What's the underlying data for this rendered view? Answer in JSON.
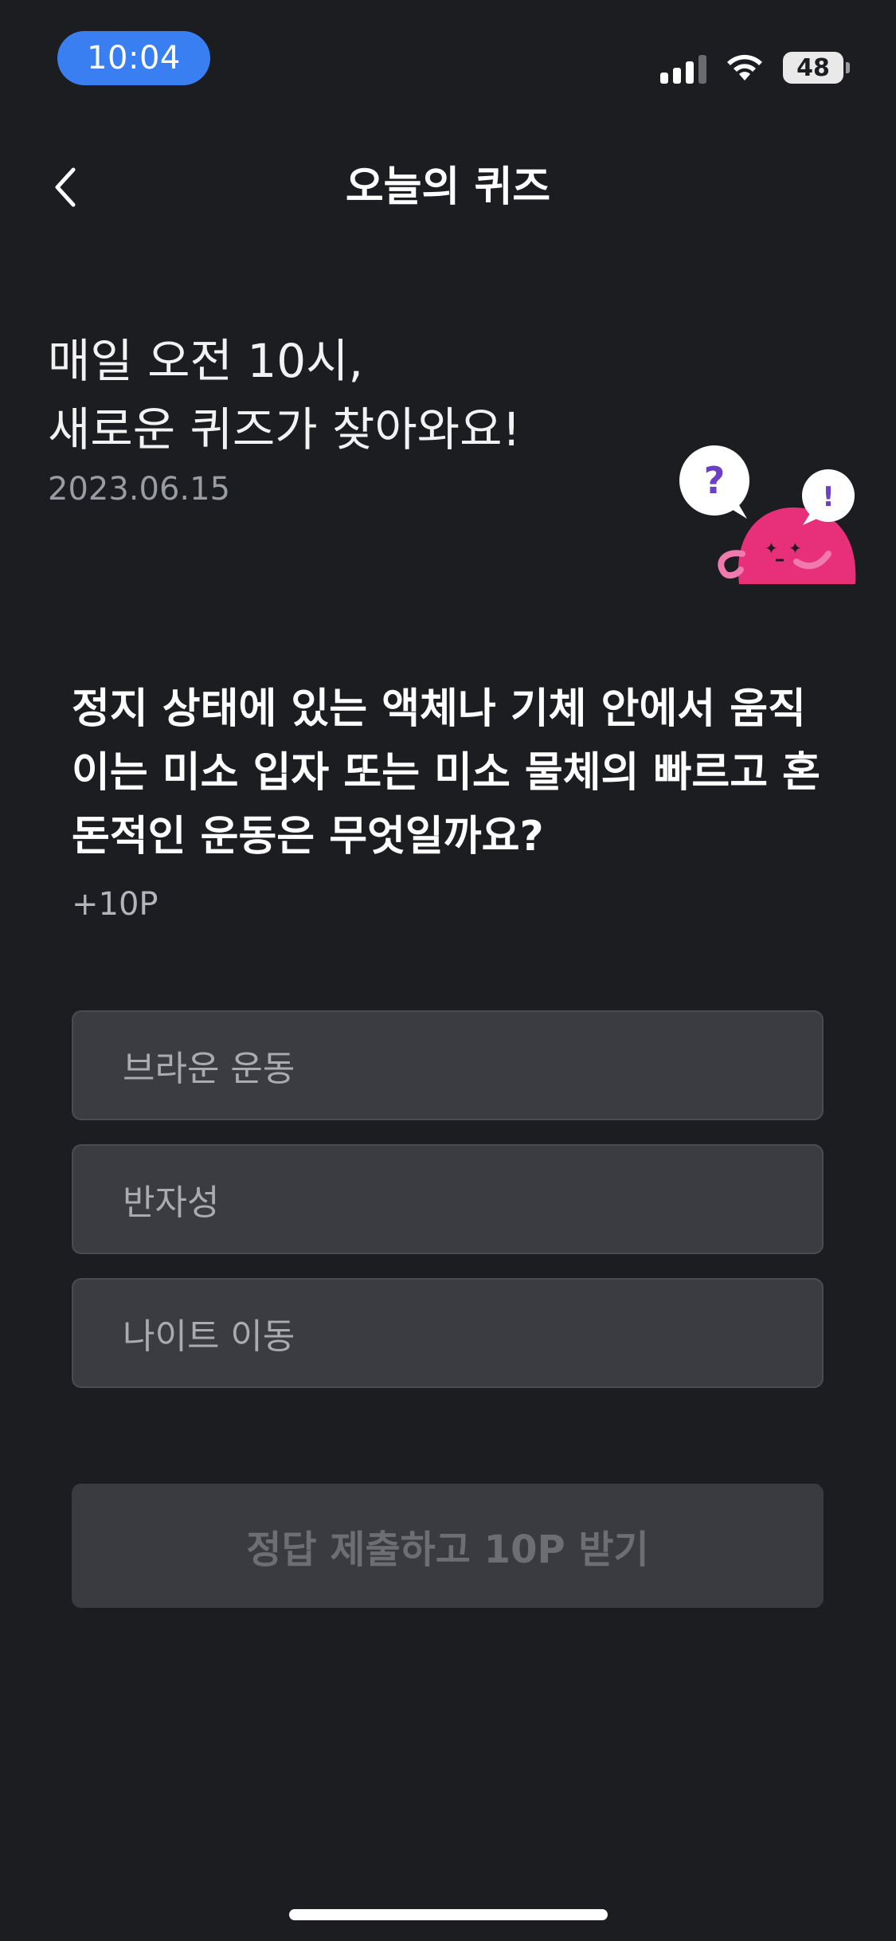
{
  "status_bar": {
    "time": "10:04",
    "battery": "48",
    "accent_color": "#3a7ff2"
  },
  "nav": {
    "title": "오늘의 퀴즈",
    "back_icon": "chevron-left-icon"
  },
  "intro": {
    "line1": "매일 오전 10시,",
    "line2": "새로운 퀴즈가 찾아와요!",
    "date": "2023.06.15"
  },
  "mascot": {
    "bubble_question": "?",
    "bubble_exclaim": "!",
    "color": "#e8307a"
  },
  "quiz": {
    "question": "정지 상태에 있는 액체나 기체 안에서 움직이는 미소 입자 또는 미소 물체의 빠르고 혼돈적인 운동은 무엇일까요?",
    "points": "+10P",
    "options": [
      {
        "label": "브라운 운동"
      },
      {
        "label": "반자성"
      },
      {
        "label": "나이트 이동"
      }
    ],
    "submit_label": "정답 제출하고 10P 받기"
  }
}
